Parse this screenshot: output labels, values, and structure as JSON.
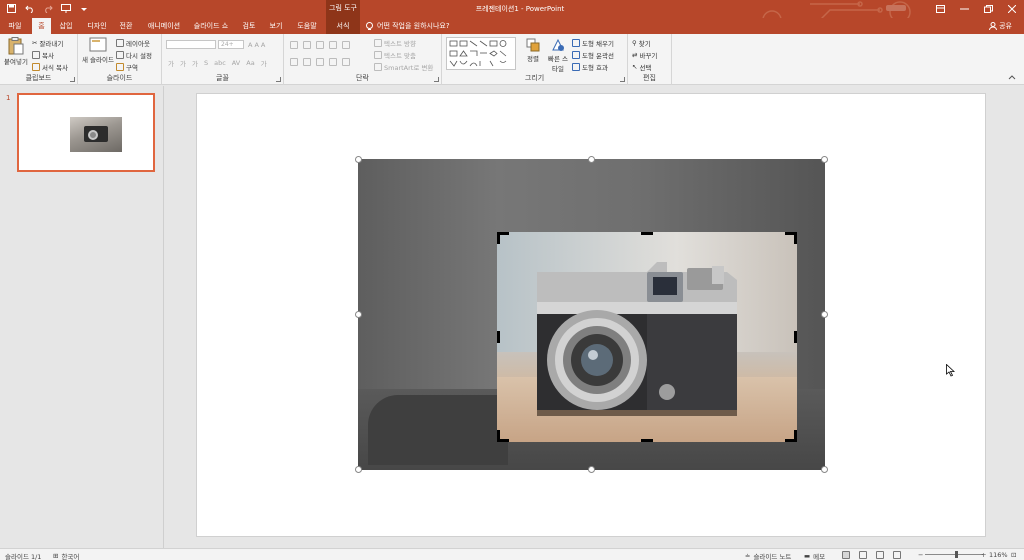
{
  "titlebar": {
    "context_tool": "그림 도구",
    "doc_title": "프레젠테이션1 - PowerPoint",
    "qat_icons": [
      "save-icon",
      "undo-icon",
      "redo-icon",
      "slideshow-icon",
      "customize-icon"
    ],
    "window_controls": [
      "ribbon-display-icon",
      "minimize-icon",
      "restore-icon",
      "close-icon"
    ],
    "colors": {
      "accent": "#b7472a",
      "context": "#8e3519"
    }
  },
  "tabs": [
    {
      "label": "파일"
    },
    {
      "label": "홈"
    },
    {
      "label": "삽입"
    },
    {
      "label": "디자인"
    },
    {
      "label": "전환"
    },
    {
      "label": "애니메이션"
    },
    {
      "label": "슬라이드 쇼"
    },
    {
      "label": "검토"
    },
    {
      "label": "보기"
    },
    {
      "label": "도움말"
    },
    {
      "label": "서식"
    }
  ],
  "tell_me": "어떤 작업을 원하시나요?",
  "share": "공유",
  "ribbon": {
    "clipboard": {
      "paste": "붙여넣기",
      "cut": "잘라내기",
      "copy": "복사",
      "format_painter": "서식 복사",
      "label": "클립보드"
    },
    "slides": {
      "new_slide": "새 슬라이드",
      "layout": "레이아웃",
      "reset": "다시 설정",
      "section": "구역",
      "label": "슬라이드"
    },
    "font": {
      "font_size": "24+",
      "label": "글꼴"
    },
    "paragraph": {
      "text_direction": "텍스트 방향",
      "align_text": "텍스트 맞춤",
      "smartart": "SmartArt로 변환",
      "label": "단락"
    },
    "drawing": {
      "arrange": "정렬",
      "quick_styles": "빠른 스타일",
      "shape_fill": "도형 채우기",
      "shape_outline": "도형 윤곽선",
      "shape_effects": "도형 효과",
      "label": "그리기"
    },
    "editing": {
      "find": "찾기",
      "replace": "바꾸기",
      "select": "선택",
      "label": "편집"
    }
  },
  "thumbnails": [
    {
      "number": "1"
    }
  ],
  "statusbar": {
    "slide_info": "슬라이드 1/1",
    "language": "한국어",
    "notes": "슬라이드 노트",
    "comments": "메모",
    "zoom": "116%",
    "zoom_level": 0.55
  }
}
